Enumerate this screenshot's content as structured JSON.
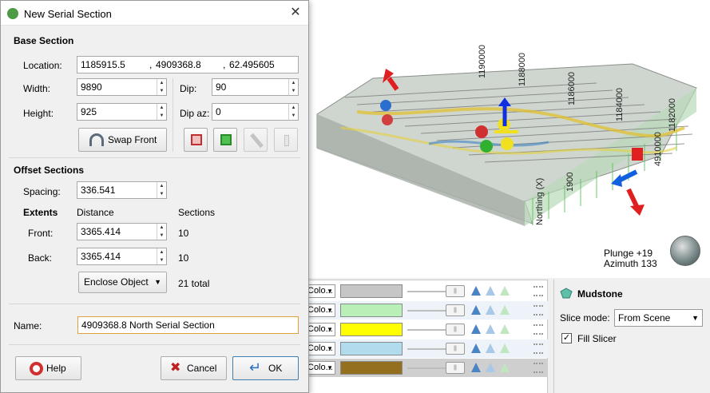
{
  "dialog": {
    "title": "New Serial Section",
    "close_glyph": "✕",
    "base_section": {
      "heading": "Base Section",
      "location_label": "Location:",
      "location_x": "1185915.5",
      "location_y": "4909368.8",
      "location_z": "62.495605",
      "comma": ",",
      "width_label": "Width:",
      "width_value": "9890",
      "height_label": "Height:",
      "height_value": "925",
      "dip_label": "Dip:",
      "dip_value": "90",
      "dip_az_label": "Dip az:",
      "dip_az_value": "0",
      "swap_front_label": "Swap Front",
      "tool_icons": [
        "section-red-cube-icon",
        "section-green-cube-icon",
        "pencil-icon",
        "small-bar-icon"
      ]
    },
    "offset_sections": {
      "heading": "Offset Sections",
      "spacing_label": "Spacing:",
      "spacing_value": "336.541",
      "extents_label": "Extents",
      "distance_header": "Distance",
      "sections_header": "Sections",
      "front_label": "Front:",
      "front_value": "3365.414",
      "front_sections": "10",
      "back_label": "Back:",
      "back_value": "3365.414",
      "back_sections": "10",
      "enclose_label": "Enclose Object",
      "total_label": "21 total"
    },
    "name_label": "Name:",
    "name_value": "4909368.8 North Serial Section",
    "help_label": "Help",
    "cancel_label": "Cancel",
    "ok_label": "OK"
  },
  "scene": {
    "axis_labels": [
      "Northing (X)",
      "1190000",
      "1188000",
      "1186000",
      "1184000",
      "1182000",
      "4910000",
      "1900"
    ],
    "plunge_text": "Plunge +19",
    "azimuth_text": "Azimuth 133"
  },
  "layers": {
    "combo_label": "Colo...",
    "rows": [
      {
        "color": "#c6c6c6"
      },
      {
        "color": "#b8f0b8"
      },
      {
        "color": "#ffff00"
      },
      {
        "color": "#b0dcee"
      },
      {
        "color": "#94701e"
      }
    ]
  },
  "properties": {
    "title": "Mudstone",
    "slice_mode_label": "Slice mode:",
    "slice_mode_value": "From Scene",
    "fill_slicer_label": "Fill Slicer",
    "fill_slicer_checked": "✓"
  },
  "colors": {
    "accent": "#3c7fb1",
    "focus_border": "#e0a040"
  }
}
